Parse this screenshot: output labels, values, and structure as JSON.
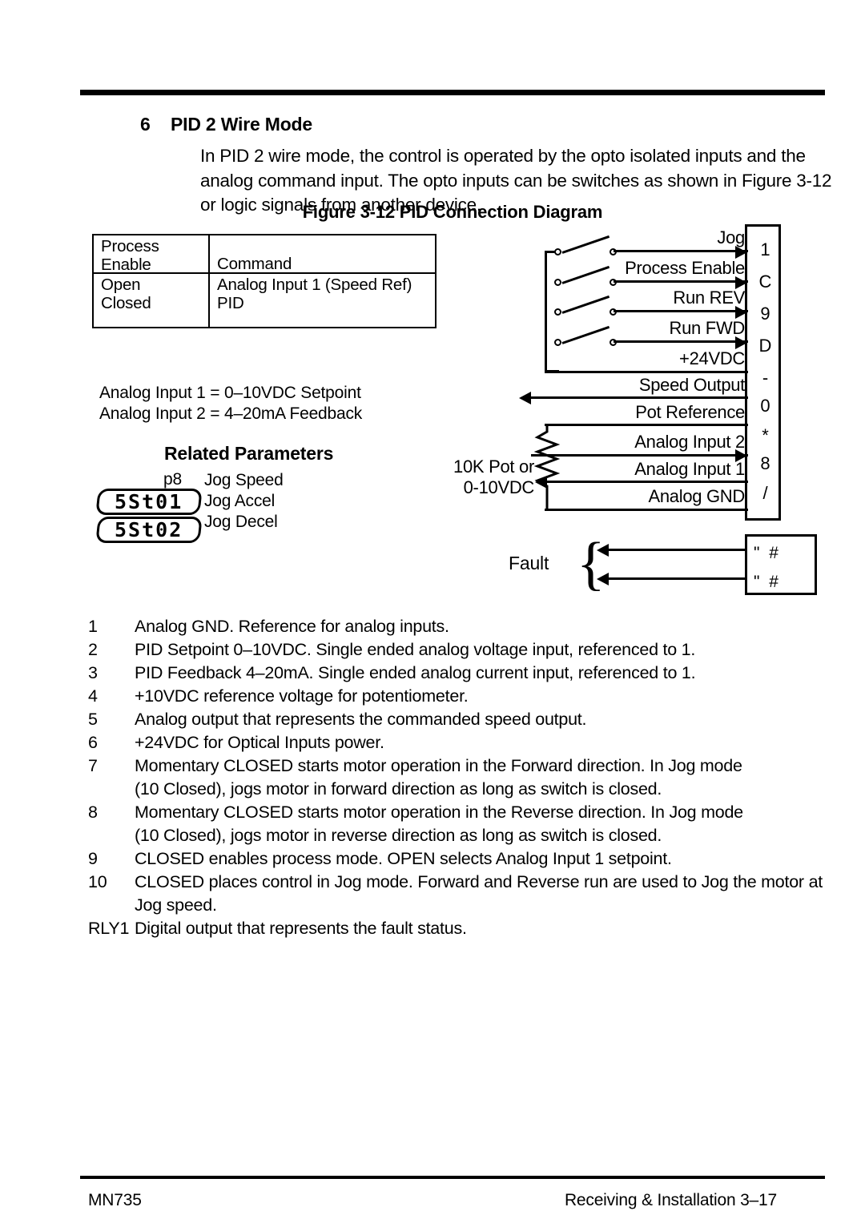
{
  "header": {
    "section_number": "6",
    "section_title": "PID 2 Wire Mode",
    "intro": "In PID 2 wire mode, the control is operated by the opto isolated inputs and the analog command input.  The opto inputs can be switches as shown in Figure 3-12 or logic signals from another device.",
    "figure_caption": "Figure 3-12  PID Connection Diagram"
  },
  "command_table": {
    "header": {
      "col1_line1": "Process",
      "col1_line2": "Enable",
      "col2": "Command"
    },
    "rows": [
      {
        "state": "Open",
        "command": "Analog Input 1 (Speed Ref)"
      },
      {
        "state": "Closed",
        "command": "PID"
      }
    ]
  },
  "analog_notes": [
    "Analog Input 1 = 0–10VDC Setpoint",
    "Analog Input 2 = 4–20mA Feedback"
  ],
  "related_parameters": {
    "title": "Related Parameters",
    "param_code": "p8",
    "items": [
      "Jog Speed",
      "Jog Accel",
      "Jog Decel"
    ],
    "displays": [
      "5St01",
      "5St02"
    ]
  },
  "diagram": {
    "terminal_characters": [
      "1",
      "C",
      "9",
      "D",
      "-",
      "0",
      "*",
      "8",
      "/"
    ],
    "signals": [
      {
        "label": "Jog",
        "direction": "in"
      },
      {
        "label": "Process Enable",
        "direction": "in"
      },
      {
        "label": "Run REV",
        "direction": "in"
      },
      {
        "label": "Run FWD",
        "direction": "in"
      },
      {
        "label": "+24VDC",
        "direction": "none"
      },
      {
        "label": "Speed Output",
        "direction": "out"
      },
      {
        "label": "Pot Reference",
        "direction": "none"
      },
      {
        "label": "Analog Input 2",
        "direction": "in"
      },
      {
        "label": "Analog Input 1",
        "direction": "out"
      },
      {
        "label": "Analog GND",
        "direction": "none"
      }
    ],
    "pot_label_line1": "10K   Pot or",
    "pot_label_line2": "0-10VDC",
    "fault_label": "Fault",
    "fault_terminals": [
      "\" #",
      "\" #"
    ]
  },
  "notes": [
    {
      "num": "1",
      "text": "Analog GND. Reference for analog inputs.",
      "cont": ""
    },
    {
      "num": "2",
      "text": "PID Setpoint 0–10VDC. Single ended analog voltage input, referenced to 1.",
      "cont": ""
    },
    {
      "num": "3",
      "text": "PID Feedback 4–20mA. Single ended analog current input, referenced to 1.",
      "cont": ""
    },
    {
      "num": "4",
      "text": "+10VDC reference voltage for potentiometer.",
      "cont": ""
    },
    {
      "num": "5",
      "text": "Analog output that represents the commanded speed output.",
      "cont": ""
    },
    {
      "num": "6",
      "text": "+24VDC for Optical Inputs power.",
      "cont": ""
    },
    {
      "num": "7",
      "text": "Momentary CLOSED starts motor operation in the Forward direction.  In Jog mode",
      "cont": "(10 Closed), jogs motor in forward direction as long as switch is closed."
    },
    {
      "num": "8",
      "text": "Momentary CLOSED starts motor operation in the Reverse direction.   In Jog mode",
      "cont": "(10 Closed), jogs motor in reverse direction as long as switch is closed."
    },
    {
      "num": "9",
      "text": "CLOSED enables process mode. OPEN selects Analog Input 1 setpoint.",
      "cont": ""
    },
    {
      "num": "10",
      "text": "CLOSED places control in Jog mode.  Forward and Reverse run are used to Jog the motor at",
      "cont": "Jog speed."
    },
    {
      "num": "RLY1",
      "text": "Digital output that represents the fault status.",
      "cont": ""
    }
  ],
  "footer": {
    "left": "MN735",
    "right": "Receiving & Installation 3–17"
  }
}
